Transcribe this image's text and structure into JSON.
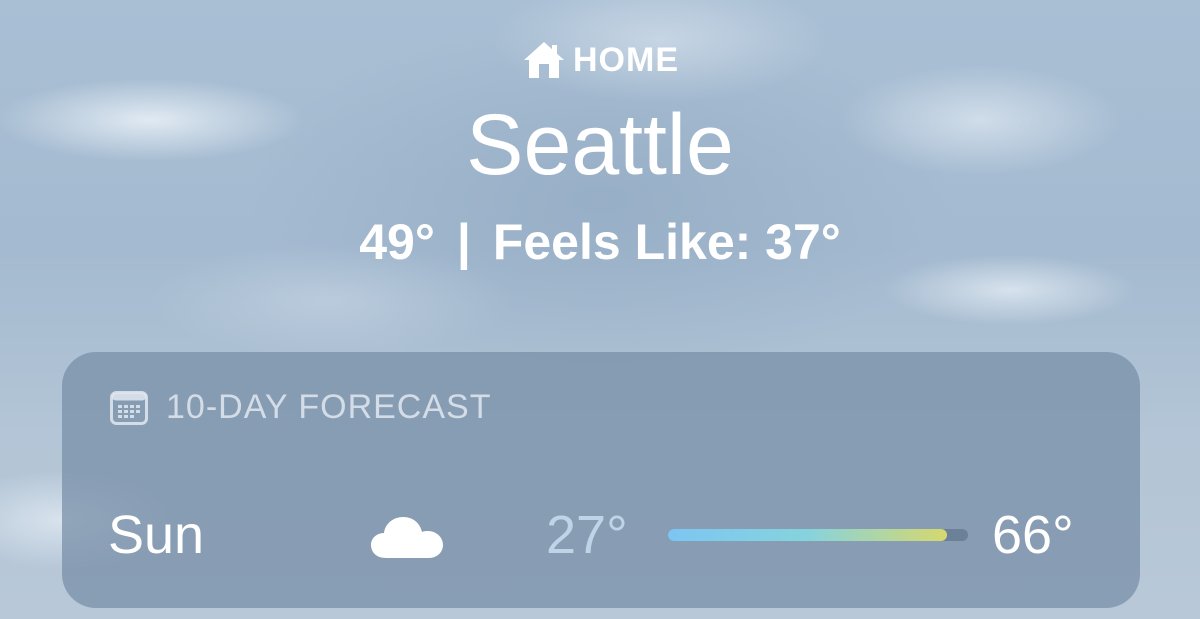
{
  "location": {
    "label": "HOME",
    "icon": "house-icon"
  },
  "city": "Seattle",
  "current": {
    "temperature": "49°",
    "separator": "|",
    "feels_like": "Feels Like: 37°"
  },
  "forecast": {
    "title": "10-DAY FORECAST",
    "icon": "calendar-icon",
    "days": [
      {
        "day": "Sun",
        "condition_icon": "cloud-icon",
        "low": "27°",
        "high": "66°",
        "range_fill_start": 0.0,
        "range_fill_end": 0.93
      }
    ]
  },
  "colors": {
    "text": "#ffffff",
    "range_cold": "#7cc6f2",
    "range_mid": "#86d3dd",
    "range_warm": "#d6d86e"
  }
}
